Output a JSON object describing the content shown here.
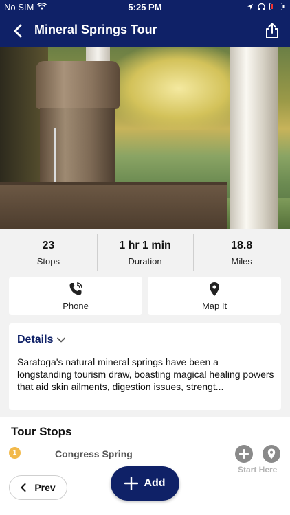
{
  "status_bar": {
    "carrier": "No SIM",
    "time": "5:25 PM"
  },
  "header": {
    "title": "Mineral Springs Tour"
  },
  "stats": [
    {
      "value": "23",
      "label": "Stops"
    },
    {
      "value": "1 hr 1 min",
      "label": "Duration"
    },
    {
      "value": "18.8",
      "label": "Miles"
    }
  ],
  "actions": {
    "phone_label": "Phone",
    "map_label": "Map It"
  },
  "details": {
    "heading": "Details",
    "text": "Saratoga's natural mineral springs have been a longstanding tourism draw, boasting magical healing powers that aid skin ailments, digestion issues, strengt..."
  },
  "tour_stops": {
    "heading": "Tour Stops",
    "items": [
      {
        "number": "1",
        "name": "Congress Spring"
      }
    ],
    "start_here_label": "Start Here"
  },
  "footer": {
    "prev_label": "Prev",
    "add_label": "Add"
  },
  "colors": {
    "primary": "#0f2167",
    "background": "#f2f2f2",
    "stop_badge": "#f2b94a",
    "icon_grey": "#8a8a8a"
  }
}
